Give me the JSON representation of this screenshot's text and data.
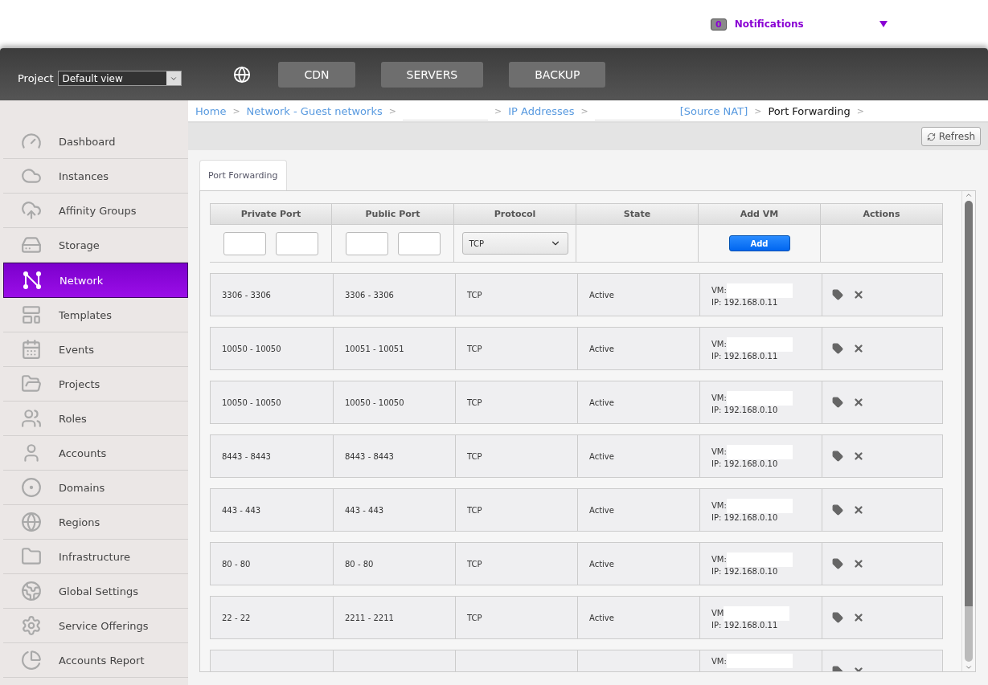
{
  "notifications": {
    "count": "0",
    "label": "Notifications"
  },
  "header": {
    "project_label": "Project",
    "project_value": "Default view",
    "nav_buttons": [
      "CDN",
      "SERVERS",
      "BACKUP"
    ]
  },
  "sidebar": {
    "items": [
      {
        "label": "Dashboard",
        "selected": false
      },
      {
        "label": "Instances",
        "selected": false
      },
      {
        "label": "Affinity Groups",
        "selected": false
      },
      {
        "label": "Storage",
        "selected": false
      },
      {
        "label": "Network",
        "selected": true
      },
      {
        "label": "Templates",
        "selected": false
      },
      {
        "label": "Events",
        "selected": false
      },
      {
        "label": "Projects",
        "selected": false
      },
      {
        "label": "Roles",
        "selected": false
      },
      {
        "label": "Accounts",
        "selected": false
      },
      {
        "label": "Domains",
        "selected": false
      },
      {
        "label": "Regions",
        "selected": false
      },
      {
        "label": "Infrastructure",
        "selected": false
      },
      {
        "label": "Global Settings",
        "selected": false
      },
      {
        "label": "Service Offerings",
        "selected": false
      },
      {
        "label": "Accounts Report",
        "selected": false
      }
    ]
  },
  "breadcrumb": [
    {
      "label": "Home",
      "kind": "link",
      "separator": ">"
    },
    {
      "label": "Network - Guest networks",
      "kind": "link",
      "separator": ">"
    },
    {
      "kind": "redacted",
      "separator": ">"
    },
    {
      "label": "IP Addresses",
      "kind": "link",
      "separator": ">"
    },
    {
      "kind": "redacted"
    },
    {
      "label": "[Source NAT]",
      "kind": "link",
      "separator": ">"
    },
    {
      "label": "Port Forwarding",
      "kind": "current",
      "separator": ">"
    }
  ],
  "refresh_button": "Refresh",
  "tabs": [
    {
      "label": "Port Forwarding",
      "selected": true
    }
  ],
  "table": {
    "columns": [
      "Private Port",
      "Public Port",
      "Protocol",
      "State",
      "Add VM",
      "Actions"
    ],
    "protocol_select": "TCP",
    "add_button": "Add",
    "rows": [
      {
        "private_port": "3306 - 3306",
        "public_port": "3306 - 3306",
        "protocol": "TCP",
        "state": "Active",
        "vm_label": "VM:",
        "ip": "IP: 192.168.0.11"
      },
      {
        "private_port": "10050 - 10050",
        "public_port": "10051 - 10051",
        "protocol": "TCP",
        "state": "Active",
        "vm_label": "VM:",
        "ip": "IP: 192.168.0.11"
      },
      {
        "private_port": "10050 - 10050",
        "public_port": "10050 - 10050",
        "protocol": "TCP",
        "state": "Active",
        "vm_label": "VM:",
        "ip": "IP: 192.168.0.10"
      },
      {
        "private_port": "8443 - 8443",
        "public_port": "8443 - 8443",
        "protocol": "TCP",
        "state": "Active",
        "vm_label": "VM:",
        "ip": "IP: 192.168.0.10"
      },
      {
        "private_port": "443 - 443",
        "public_port": "443 - 443",
        "protocol": "TCP",
        "state": "Active",
        "vm_label": "VM:",
        "ip": "IP: 192.168.0.10"
      },
      {
        "private_port": "80 - 80",
        "public_port": "80 - 80",
        "protocol": "TCP",
        "state": "Active",
        "vm_label": "VM:",
        "ip": "IP: 192.168.0.10"
      },
      {
        "private_port": "22 - 22",
        "public_port": "2211 - 2211",
        "protocol": "TCP",
        "state": "Active",
        "vm_label": "VM",
        "ip": "IP: 192.168.0.11"
      },
      {
        "vm_label": "VM:"
      }
    ]
  }
}
